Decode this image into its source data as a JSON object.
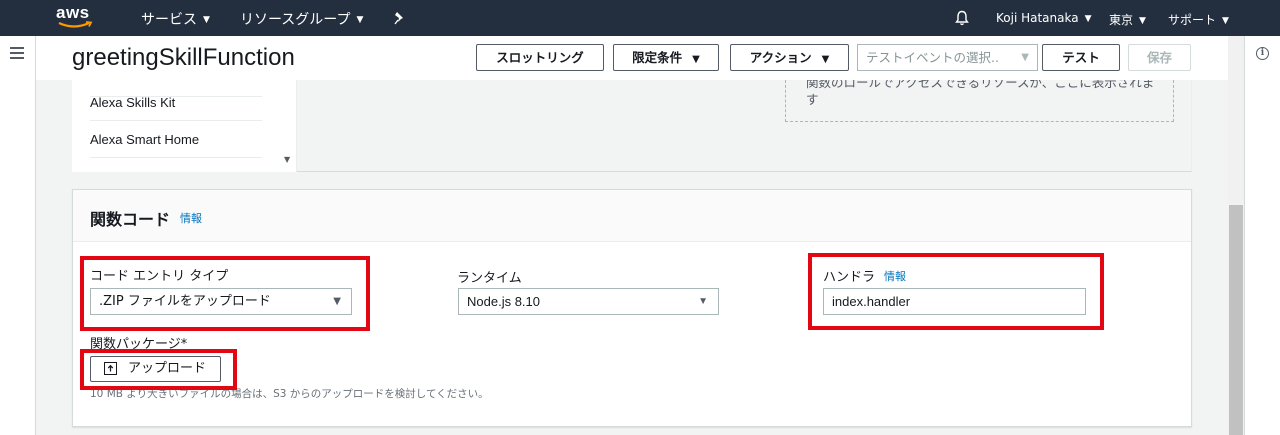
{
  "topnav": {
    "logo_text": "aws",
    "services_label": "サービス",
    "resource_groups_label": "リソースグループ",
    "user_name": "Koji Hatanaka",
    "region": "東京",
    "support_label": "サポート",
    "icons": [
      "pin-icon",
      "bell-icon",
      "caret-down-icon"
    ]
  },
  "header": {
    "title": "greetingSkillFunction",
    "throttling_button": "スロットリング",
    "qualifiers_button": "限定条件",
    "actions_button": "アクション",
    "test_event_placeholder": "テストイベントの選択..",
    "test_button": "テスト",
    "save_button": "保存"
  },
  "triggers": {
    "items": [
      "Alexa Skills Kit",
      "Alexa Smart Home"
    ]
  },
  "resources_note": "関数のロールでアクセスできるリソースが、ここに表示されます",
  "function_code": {
    "title": "関数コード",
    "info_link": "情報",
    "code_entry_type_label": "コード エントリ タイプ",
    "code_entry_type_value": ".ZIP ファイルをアップロード",
    "runtime_label": "ランタイム",
    "runtime_value": "Node.js 8.10",
    "handler_label": "ハンドラ",
    "handler_info_link": "情報",
    "handler_value": "index.handler",
    "package_label": "関数パッケージ*",
    "upload_button": "アップロード",
    "hint": "10 MB より大きいファイルの場合は、S3 からのアップロードを検討してください。"
  },
  "colors": {
    "nav_bg": "#232f3e",
    "highlight": "#e30613",
    "link": "#0073bb"
  }
}
